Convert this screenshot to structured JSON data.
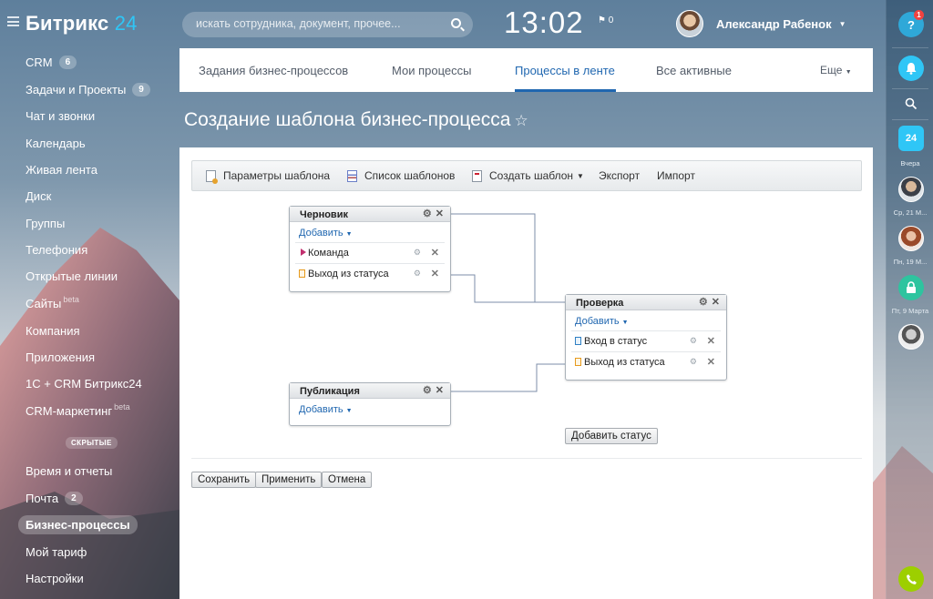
{
  "header": {
    "logo_main": "Битрикс",
    "logo_num": "24",
    "search_placeholder": "искать сотрудника, документ, прочее...",
    "time": "13:02",
    "flag_count": "0",
    "user_name": "Александр Рабенок"
  },
  "leftnav": {
    "items": [
      {
        "label": "CRM",
        "badge": "6"
      },
      {
        "label": "Задачи и Проекты",
        "badge": "9"
      },
      {
        "label": "Чат и звонки"
      },
      {
        "label": "Календарь"
      },
      {
        "label": "Живая лента"
      },
      {
        "label": "Диск"
      },
      {
        "label": "Группы"
      },
      {
        "label": "Телефония"
      },
      {
        "label": "Открытые линии"
      },
      {
        "label": "Сайты",
        "sup": "beta"
      },
      {
        "label": "Компания"
      },
      {
        "label": "Приложения"
      },
      {
        "label": "1С + CRM Битрикс24"
      },
      {
        "label": "CRM-маркетинг",
        "sup": "beta"
      }
    ],
    "hidden_label": "СКРЫТЫЕ",
    "hidden_items": [
      {
        "label": "Время и отчеты"
      },
      {
        "label": "Почта",
        "badge": "2"
      },
      {
        "label": "Бизнес-процессы",
        "active": true
      },
      {
        "label": "Мой тариф"
      },
      {
        "label": "Настройки"
      }
    ]
  },
  "tabs": {
    "items": [
      "Задания бизнес-процессов",
      "Мои процессы",
      "Процессы в ленте",
      "Все активные"
    ],
    "active": "Процессы в ленте",
    "more": "Еще"
  },
  "page": {
    "title": "Создание шаблона бизнес-процесса",
    "star": "☆"
  },
  "toolbar": {
    "params": "Параметры шаблона",
    "list": "Список шаблонов",
    "create": "Создать шаблон",
    "export": "Экспорт",
    "import": "Импорт"
  },
  "states": {
    "add_label": "Добавить",
    "draft": {
      "title": "Черновик",
      "rows": [
        "Команда",
        "Выход из статуса"
      ]
    },
    "review": {
      "title": "Проверка",
      "rows": [
        "Вход в статус",
        "Выход из статуса"
      ]
    },
    "publish": {
      "title": "Публикация"
    }
  },
  "buttons": {
    "add_status": "Добавить статус",
    "save": "Сохранить",
    "apply": "Применить",
    "cancel": "Отмена"
  },
  "rightbar": {
    "help": "?",
    "help_badge": "1",
    "bitrix_badge": "24",
    "labels": [
      "Вчера",
      "Ср, 21 М...",
      "Пн, 19 М...",
      "Пт, 9 Марта"
    ]
  },
  "colors": {
    "accent": "#2067b0",
    "brand_blue": "#2fc6f6",
    "phone_green": "#9dcf00",
    "connector": "#7c8ea8"
  },
  "icons": [
    "menu-icon",
    "search-icon",
    "flag-icon",
    "chevron-down-icon",
    "gear-icon",
    "close-icon",
    "help-icon",
    "bell-icon",
    "lock-icon",
    "phone-icon"
  ]
}
